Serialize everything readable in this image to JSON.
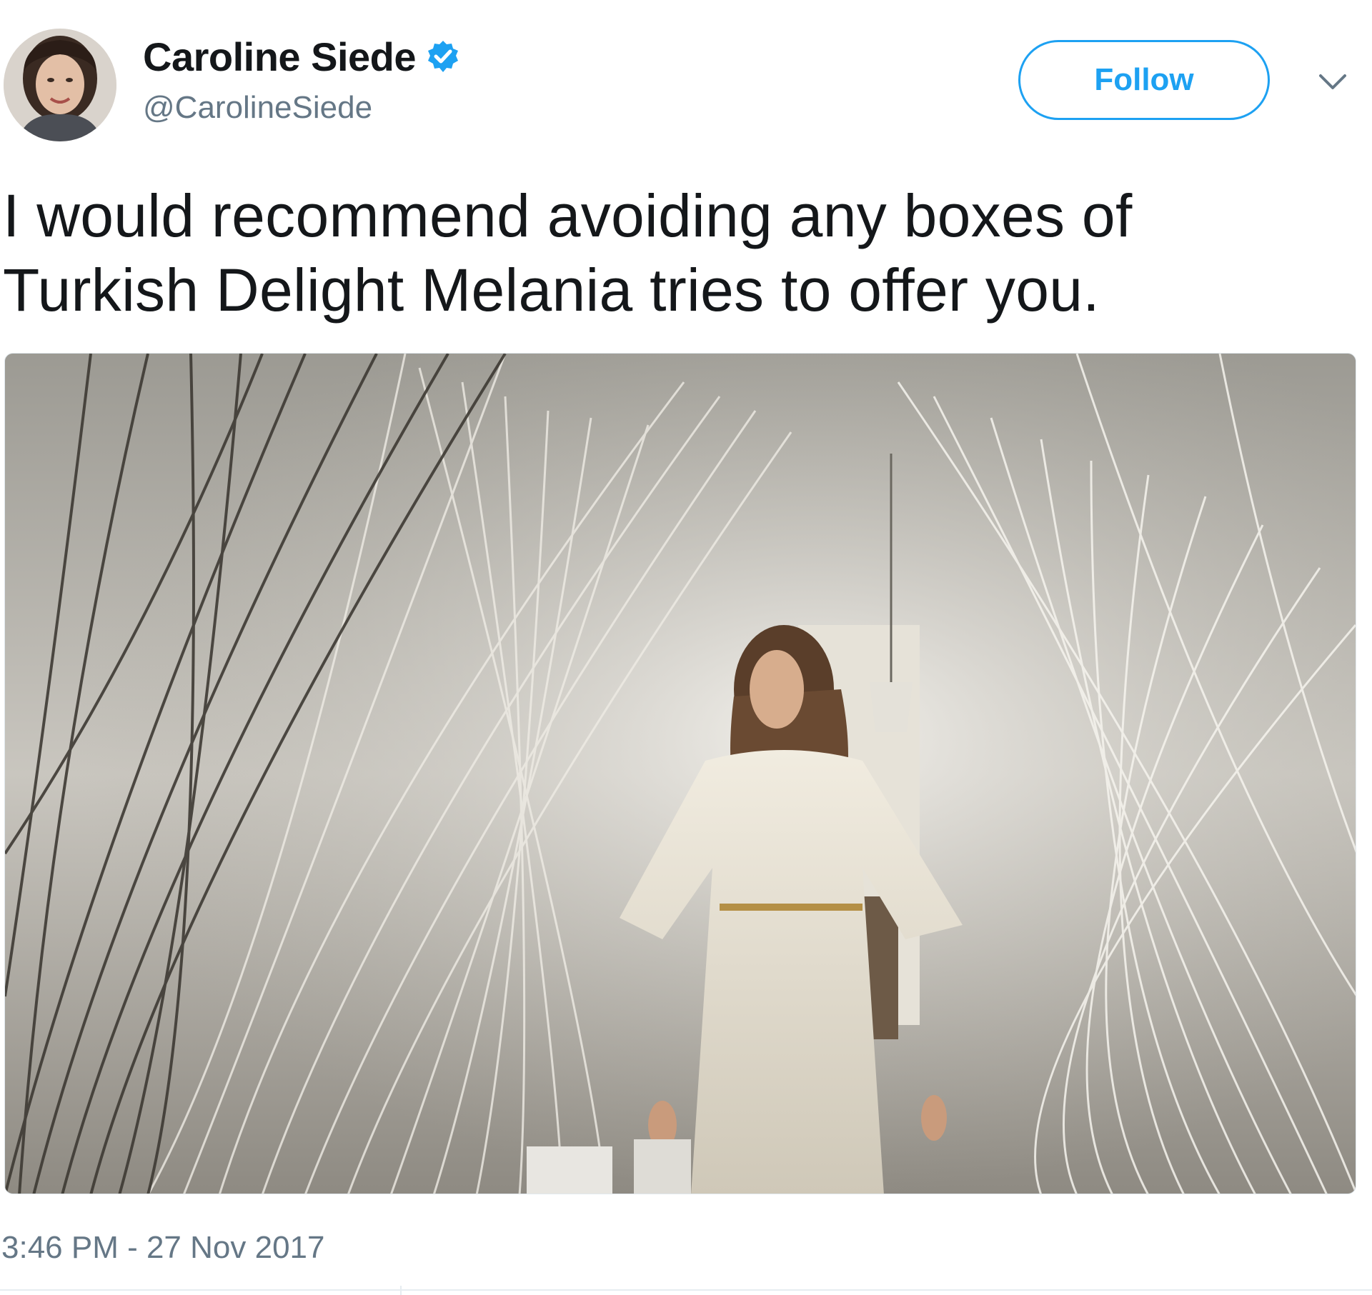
{
  "tweet": {
    "author": {
      "display_name": "Caroline Siede",
      "handle": "@CarolineSiede",
      "verified": true
    },
    "follow_label": "Follow",
    "text": "I would recommend avoiding any boxes of\nTurkish Delight Melania tries to offer you.",
    "timestamp": "3:46 PM - 27 Nov 2017"
  },
  "colors": {
    "accent": "#1da1f2",
    "text_primary": "#14171a",
    "text_secondary": "#657786",
    "border": "#e1e8ed"
  },
  "icons": {
    "verified": "verified-badge-icon",
    "caret": "chevron-down-icon"
  }
}
